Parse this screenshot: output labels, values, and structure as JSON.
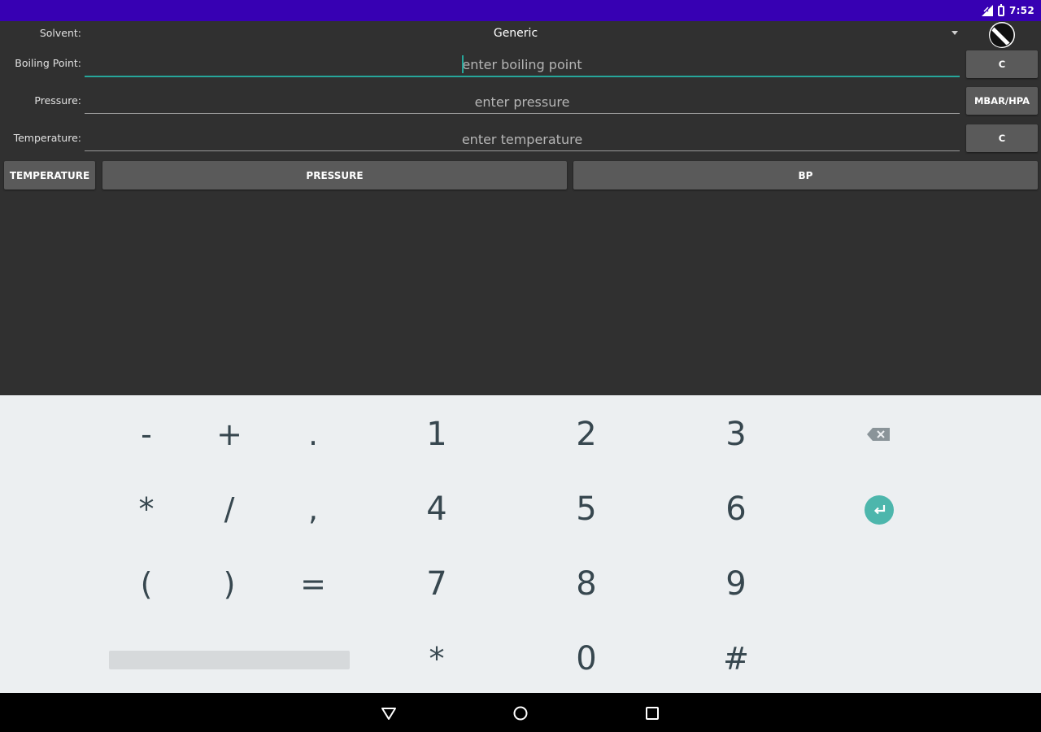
{
  "status_bar": {
    "time": "7:52"
  },
  "form": {
    "solvent_label": "Solvent:",
    "solvent_value": "Generic",
    "boiling_point_label": "Boiling Point:",
    "boiling_point_placeholder": "enter boiling point",
    "boiling_point_unit": "C",
    "pressure_label": "Pressure:",
    "pressure_placeholder": "enter pressure",
    "pressure_unit": "MBAR/HPA",
    "temperature_label": "Temperature:",
    "temperature_placeholder": "enter temperature",
    "temperature_unit": "C"
  },
  "actions": {
    "temperature": "TEMPERATURE",
    "pressure": "PRESSURE",
    "bp": "BP"
  },
  "keyboard": {
    "row1": [
      "-",
      "+",
      ".",
      "1",
      "2",
      "3"
    ],
    "row2": [
      "*",
      "/",
      ",",
      "4",
      "5",
      "6"
    ],
    "row3": [
      "(",
      ")",
      "=",
      "7",
      "8",
      "9"
    ],
    "row4": [
      "*",
      "0",
      "#"
    ]
  },
  "icons": {
    "theme": "contrast-icon",
    "backspace": "backspace-icon",
    "enter": "enter-icon",
    "back": "nav-back-icon",
    "home": "nav-home-icon",
    "recents": "nav-recents-icon"
  },
  "colors": {
    "status_bar": "#3700b3",
    "accent": "#26a69a",
    "background": "#303030",
    "button": "#5a5a5a",
    "keyboard": "#eceff1"
  }
}
